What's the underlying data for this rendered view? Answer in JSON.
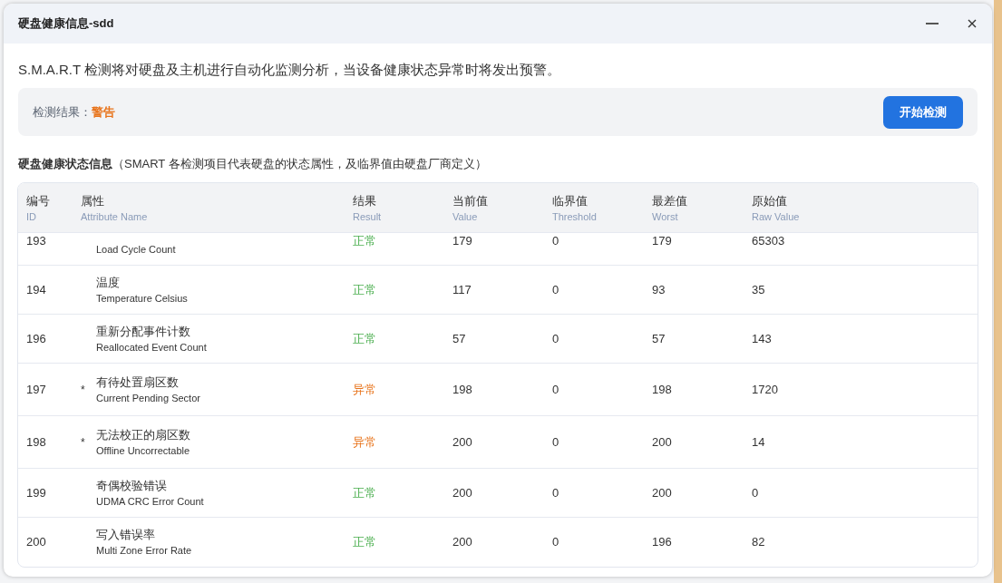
{
  "window": {
    "title": "硬盘健康信息-sdd"
  },
  "description": "S.M.A.R.T 检测将对硬盘及主机进行自动化监测分析，当设备健康状态异常时将发出预警。",
  "result": {
    "label": "检测结果：",
    "value": "警告",
    "color": "#e8741c",
    "button": "开始检测"
  },
  "section": {
    "title": "硬盘健康状态信息",
    "note": "（SMART 各检测项目代表硬盘的状态属性，及临界值由硬盘厂商定义）"
  },
  "table": {
    "columns": [
      {
        "zh": "编号",
        "en": "ID"
      },
      {
        "zh": "属性",
        "en": "Attribute Name"
      },
      {
        "zh": "结果",
        "en": "Result"
      },
      {
        "zh": "当前值",
        "en": "Value"
      },
      {
        "zh": "临界值",
        "en": "Threshold"
      },
      {
        "zh": "最差值",
        "en": "Worst"
      },
      {
        "zh": "原始值",
        "en": "Raw Value"
      }
    ],
    "rows": [
      {
        "id": "193",
        "name_en": "Load Cycle Count",
        "result": "正常",
        "color": "#4caf50",
        "value": "179",
        "threshold": "0",
        "worst": "179",
        "raw": "65303"
      },
      {
        "id": "194",
        "name_zh": "温度",
        "name_en": "Temperature Celsius",
        "result": "正常",
        "color": "#4caf50",
        "value": "117",
        "threshold": "0",
        "worst": "93",
        "raw": "35"
      },
      {
        "id": "196",
        "name_zh": "重新分配事件计数",
        "name_en": "Reallocated Event Count",
        "result": "正常",
        "color": "#4caf50",
        "value": "57",
        "threshold": "0",
        "worst": "57",
        "raw": "143"
      },
      {
        "id": "197",
        "mark": "*",
        "name_zh": "有待处置扇区数",
        "name_en": "Current Pending Sector",
        "result": "异常",
        "color": "#e8741c",
        "value": "198",
        "threshold": "0",
        "worst": "198",
        "raw": "1720"
      },
      {
        "id": "198",
        "mark": "*",
        "name_zh": "无法校正的扇区数",
        "name_en": "Offline Uncorrectable",
        "result": "异常",
        "color": "#e8741c",
        "value": "200",
        "threshold": "0",
        "worst": "200",
        "raw": "14"
      },
      {
        "id": "199",
        "name_zh": "奇偶校验错误",
        "name_en": "UDMA CRC Error Count",
        "result": "正常",
        "color": "#4caf50",
        "value": "200",
        "threshold": "0",
        "worst": "200",
        "raw": "0"
      },
      {
        "id": "200",
        "name_zh": "写入错误率",
        "name_en": "Multi Zone Error Rate",
        "result": "正常",
        "color": "#4caf50",
        "value": "200",
        "threshold": "0",
        "worst": "196",
        "raw": "82"
      }
    ]
  }
}
